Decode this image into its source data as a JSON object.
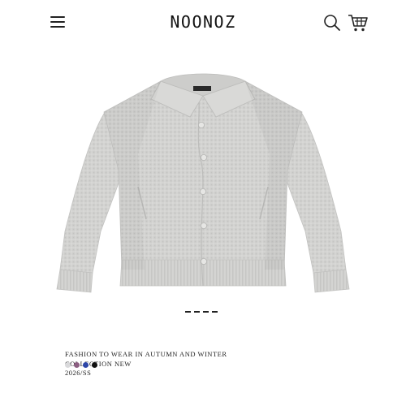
{
  "header": {
    "brand": "NOONOZ",
    "menu_icon": "hamburger-menu-icon",
    "search_icon": "search-icon",
    "cart_icon": "shopping-cart-icon"
  },
  "product": {
    "image": "grey waffle-knit cardigan with collar and buttons",
    "color": "#d7d7d5"
  },
  "carousel": {
    "slides": 4
  },
  "collection": {
    "line1": "FASHION TO WEAR IN AUTUMN AND WINTER",
    "line2": "COLLECTION NEW",
    "line3": "2026/SS"
  },
  "swatches": [
    {
      "name": "light grey",
      "color": "#d9d9db"
    },
    {
      "name": "mauve",
      "color": "#8c5f82"
    },
    {
      "name": "blue",
      "color": "#2e47a8"
    },
    {
      "name": "black",
      "color": "#111111"
    }
  ]
}
